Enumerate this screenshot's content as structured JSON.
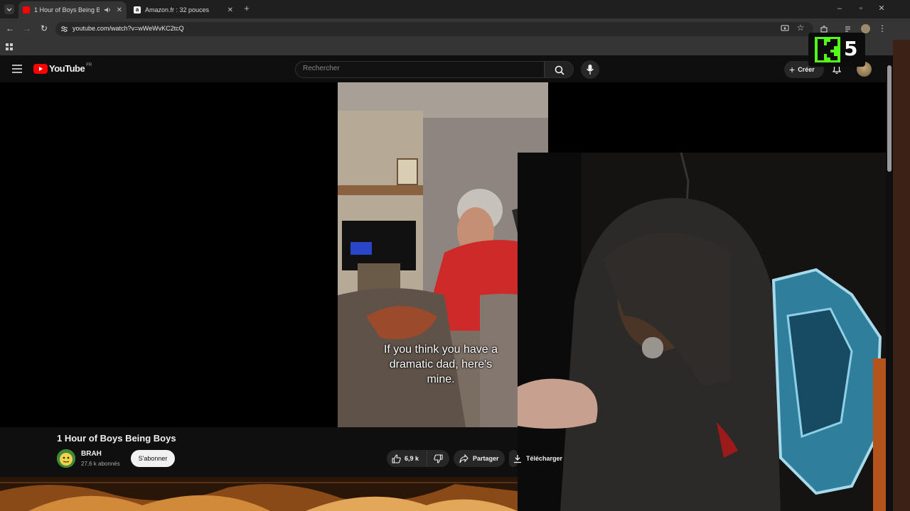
{
  "browser": {
    "tabs": [
      {
        "title": "1 Hour of Boys Being Boys",
        "favicon": "youtube-favicon",
        "active": true,
        "audio_icon": "speaker-icon"
      },
      {
        "title": "Amazon.fr : 32 pouces",
        "favicon": "amazon-favicon",
        "active": false
      }
    ],
    "new_tab_symbol": "+",
    "url": "youtube.com/watch?v=wWeWvKC2tcQ"
  },
  "youtube": {
    "logo_text": "YouTube",
    "region": "FR",
    "search_placeholder": "Rechercher",
    "create_label": "Créer"
  },
  "video": {
    "caption_lines": [
      "If you think you have a",
      "dramatic dad, here's",
      "mine."
    ],
    "title": "1 Hour of Boys Being Boys",
    "channel": "BRAH",
    "subscribers": "27,6 k abonnés",
    "subscribe_label": "S'abonner",
    "likes": "6,9 k",
    "share_label": "Partager",
    "download_label": "Télécharger"
  },
  "overlay": {
    "badge_letter": "K",
    "badge_number": "5",
    "badge_color": "#53fc18"
  }
}
